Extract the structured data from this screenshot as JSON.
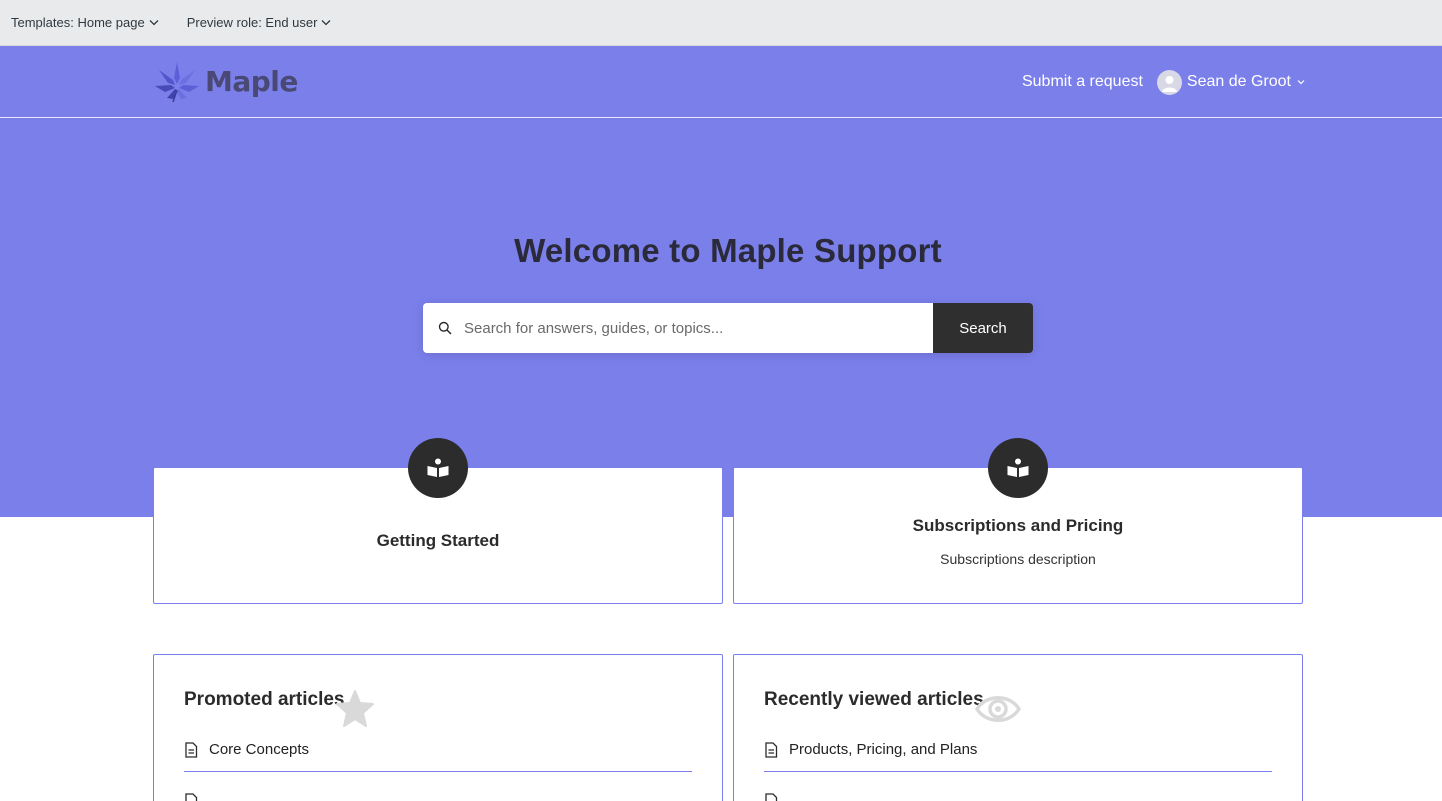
{
  "preview_bar": {
    "template_label": "Templates: Home page",
    "role_label": "Preview role: End user"
  },
  "header": {
    "logo_text": "Maple",
    "submit_request": "Submit a request",
    "user_name": "Sean de Groot"
  },
  "hero": {
    "title": "Welcome to Maple Support",
    "search_placeholder": "Search for answers, guides, or topics...",
    "search_button": "Search"
  },
  "categories": [
    {
      "title": "Getting Started",
      "description": "",
      "icon": "open-book-icon"
    },
    {
      "title": "Subscriptions and Pricing",
      "description": "Subscriptions description",
      "icon": "open-book-icon"
    }
  ],
  "promoted": {
    "title": "Promoted articles",
    "icon": "star-icon",
    "articles": [
      "Core Concepts"
    ]
  },
  "recent": {
    "title": "Recently viewed articles",
    "icon": "eye-icon",
    "articles": [
      "Products, Pricing, and Plans"
    ]
  },
  "colors": {
    "brand": "#7b7fea",
    "dark": "#2f2f2f",
    "toolbar": "#e9eaeb"
  }
}
